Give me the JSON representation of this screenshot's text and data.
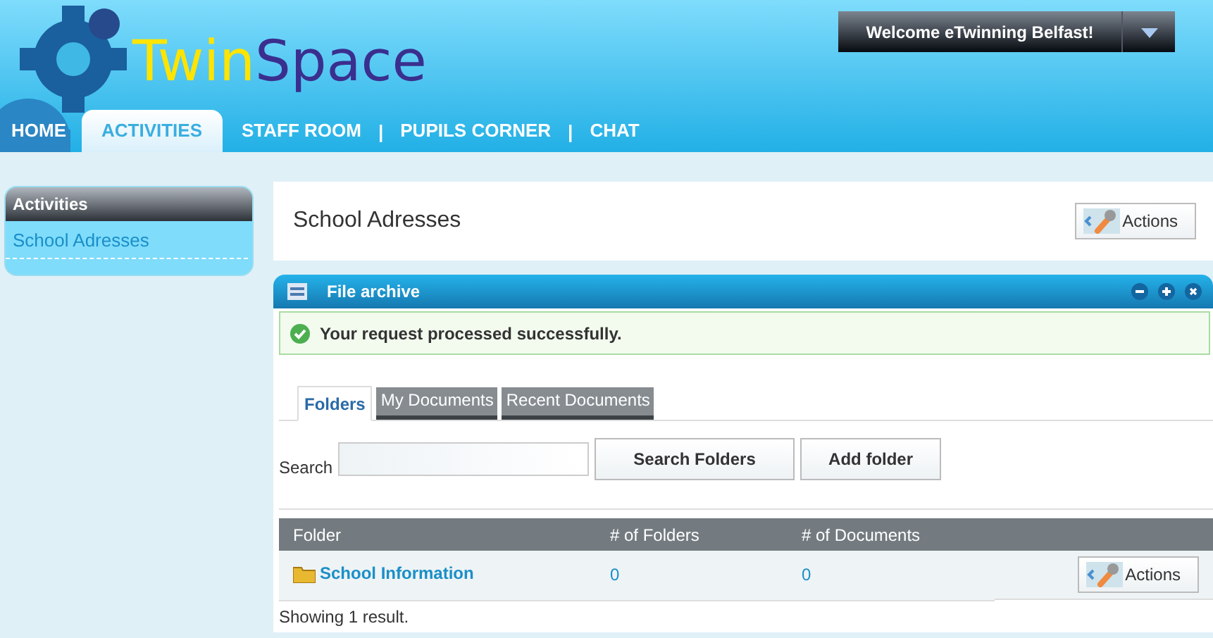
{
  "header": {
    "logo_part_1": "Twin",
    "logo_part_2": "Space",
    "welcome": "Welcome eTwinning Belfast!"
  },
  "nav": [
    {
      "kind": "tab",
      "label": "HOME",
      "selected": false
    },
    {
      "kind": "tab",
      "label": "ACTIVITIES",
      "selected": true
    },
    {
      "kind": "tab",
      "label": "STAFF ROOM",
      "selected": false
    },
    {
      "kind": "separator",
      "label": "|"
    },
    {
      "kind": "tab",
      "label": "PUPILS CORNER",
      "selected": false
    },
    {
      "kind": "separator",
      "label": "|"
    },
    {
      "kind": "tab",
      "label": "CHAT",
      "selected": false
    }
  ],
  "sidebar": {
    "title": "Activities",
    "items": [
      {
        "label": "School Adresses"
      }
    ]
  },
  "page": {
    "title": "School Adresses",
    "actions": "Actions"
  },
  "file_archive": {
    "title": "File archive",
    "message": "Your request processed successfully.",
    "tabs": [
      {
        "label": "Folders",
        "selected": true
      },
      {
        "label": "My Documents",
        "selected": false
      },
      {
        "label": "Recent Documents",
        "selected": false
      }
    ],
    "search_label": "Search",
    "search_button": "Search Folders",
    "add_button": "Add folder",
    "table": {
      "columns": [
        "Folder",
        "# of Folders",
        "# of Documents"
      ],
      "rows": [
        {
          "folder": "School Information",
          "folders": "0",
          "documents": "0",
          "actions": "Actions"
        }
      ]
    },
    "footer": "Showing 1 result."
  }
}
